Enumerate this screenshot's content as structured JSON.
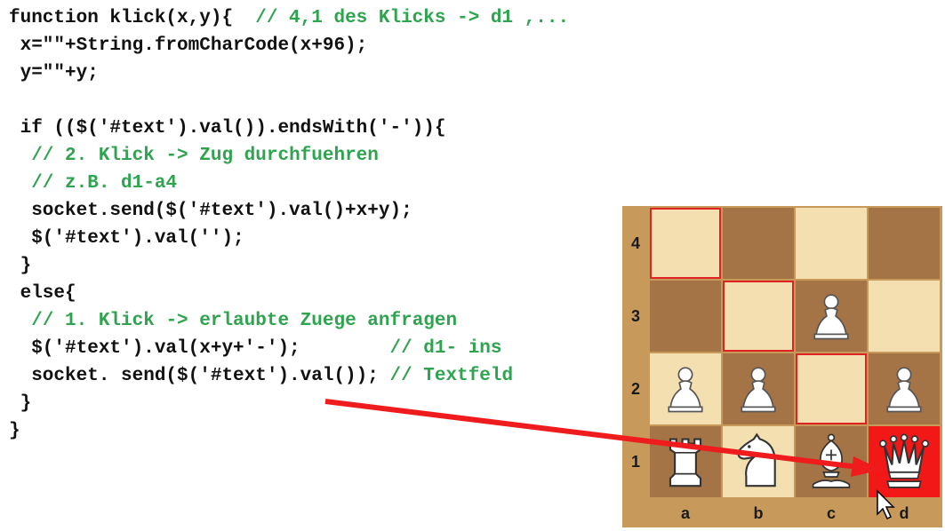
{
  "code": {
    "lines": [
      {
        "code": "function klick(x,y){  ",
        "comment": "// 4,1 des Klicks -> d1 ,..."
      },
      {
        "code": " x=\"\"+String.fromCharCode(x+96);",
        "comment": ""
      },
      {
        "code": " y=\"\"+y;",
        "comment": ""
      },
      {
        "code": "",
        "comment": ""
      },
      {
        "code": " if (($('#text').val()).endsWith('-')){",
        "comment": ""
      },
      {
        "code": "  ",
        "comment": "// 2. Klick -> Zug durchfuehren"
      },
      {
        "code": "  ",
        "comment": "// z.B. d1-a4"
      },
      {
        "code": "  socket.send($('#text').val()+x+y);",
        "comment": ""
      },
      {
        "code": "  $('#text').val('');",
        "comment": ""
      },
      {
        "code": " }",
        "comment": ""
      },
      {
        "code": " else{",
        "comment": ""
      },
      {
        "code": "  ",
        "comment": "// 1. Klick -> erlaubte Zuege anfragen"
      },
      {
        "code": "  $('#text').val(x+y+'-');        ",
        "comment": "// d1- ins"
      },
      {
        "code": "  socket. send($('#text').val()); ",
        "comment": "// Textfeld"
      },
      {
        "code": " }",
        "comment": ""
      },
      {
        "code": "}",
        "comment": ""
      }
    ]
  },
  "board": {
    "ranks": [
      "4",
      "3",
      "2",
      "1"
    ],
    "files": [
      "a",
      "b",
      "c",
      "d"
    ],
    "colors": {
      "light": "#f4dfb0",
      "dark": "#a47447",
      "highlight": "#e02222",
      "target": "#f21818",
      "frame": "#c79a5b"
    },
    "squares": [
      {
        "name": "a4",
        "color": "light",
        "highlight": true,
        "piece": ""
      },
      {
        "name": "b4",
        "color": "dark",
        "highlight": false,
        "piece": ""
      },
      {
        "name": "c4",
        "color": "light",
        "highlight": false,
        "piece": ""
      },
      {
        "name": "d4",
        "color": "dark",
        "highlight": false,
        "piece": ""
      },
      {
        "name": "a3",
        "color": "dark",
        "highlight": false,
        "piece": ""
      },
      {
        "name": "b3",
        "color": "light",
        "highlight": true,
        "piece": ""
      },
      {
        "name": "c3",
        "color": "dark",
        "highlight": false,
        "piece": "pawn"
      },
      {
        "name": "d3",
        "color": "light",
        "highlight": false,
        "piece": ""
      },
      {
        "name": "a2",
        "color": "light",
        "highlight": false,
        "piece": "pawn"
      },
      {
        "name": "b2",
        "color": "dark",
        "highlight": false,
        "piece": "pawn"
      },
      {
        "name": "c2",
        "color": "light",
        "highlight": true,
        "piece": ""
      },
      {
        "name": "d2",
        "color": "dark",
        "highlight": false,
        "piece": "pawn"
      },
      {
        "name": "a1",
        "color": "dark",
        "highlight": false,
        "piece": "rook"
      },
      {
        "name": "b1",
        "color": "light",
        "highlight": false,
        "piece": "knight"
      },
      {
        "name": "c1",
        "color": "dark",
        "highlight": false,
        "piece": "bishop"
      },
      {
        "name": "d1",
        "color": "target",
        "highlight": false,
        "piece": "queen"
      }
    ]
  },
  "annotation": {
    "arrow_color": "#ee1c1c",
    "cursor": "arrow-cursor-icon"
  }
}
